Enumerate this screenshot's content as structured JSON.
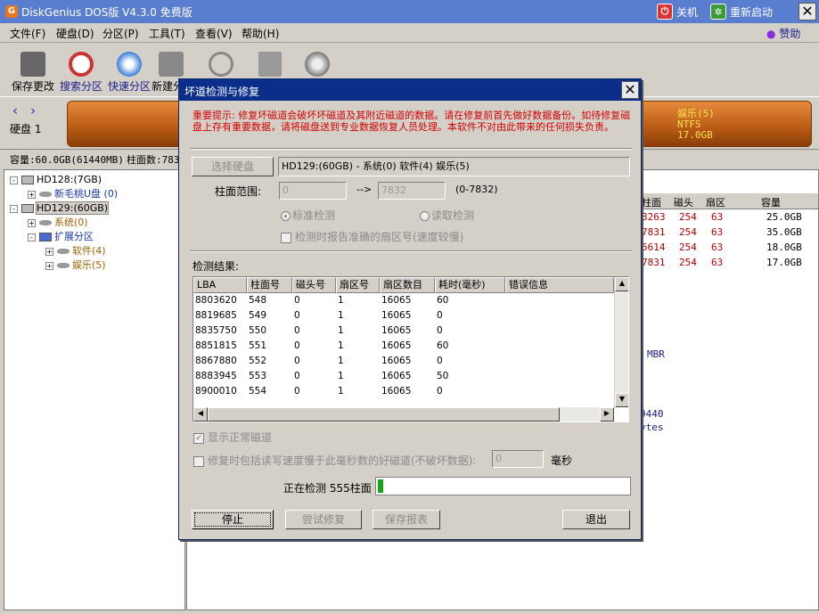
{
  "app": {
    "title": "DiskGenius DOS版 V4.3.0 免费版",
    "logo": "G",
    "shutdown": "关机",
    "restart": "重新启动"
  },
  "menu": [
    "文件(F)",
    "硬盘(D)",
    "分区(P)",
    "工具(T)",
    "查看(V)",
    "帮助(H)"
  ],
  "sponsor": "赞助",
  "toolbar": [
    "保存更改",
    "搜索分区",
    "快速分区",
    "新建分"
  ],
  "diskbar": {
    "disk_label": "硬盘 1",
    "partition_name": "娱乐(5)",
    "partition_fs": "NTFS",
    "partition_size": "17.0GB"
  },
  "infoline": {
    "capacity": "容量:60.0GB(61440MB)",
    "cylinders": "柱面数:783"
  },
  "tree": [
    {
      "label": "HD128:(7GB)",
      "level": 0,
      "exp": "-",
      "icon": "hd"
    },
    {
      "label": "新毛桃U盘 (0)",
      "level": 1,
      "exp": "+",
      "icon": "pt",
      "color": "#1a3aa8"
    },
    {
      "label": "HD129:(60GB)",
      "level": 0,
      "exp": "-",
      "icon": "hd",
      "selected": true
    },
    {
      "label": "系统(0)",
      "level": 1,
      "exp": "+",
      "icon": "pt",
      "color": "#a06000"
    },
    {
      "label": "扩展分区",
      "level": 1,
      "exp": "-",
      "icon": "ext",
      "color": "#1a3aa8"
    },
    {
      "label": "软件(4)",
      "level": 2,
      "exp": "+",
      "icon": "pt",
      "color": "#a06000"
    },
    {
      "label": "娱乐(5)",
      "level": 2,
      "exp": "+",
      "icon": "pt",
      "color": "#a06000"
    }
  ],
  "right_table": {
    "headers": [
      "柱面",
      "磁头",
      "扇区",
      "容量"
    ],
    "rows": [
      [
        "3263",
        "254",
        "63",
        "25.0GB"
      ],
      [
        "7831",
        "254",
        "63",
        "35.0GB"
      ],
      [
        "5614",
        "254",
        "63",
        "18.0GB"
      ],
      [
        "7831",
        "254",
        "63",
        "17.0GB"
      ]
    ],
    "mbr": "MBR",
    "num": "9440",
    "bytes": "ytes"
  },
  "dialog": {
    "title": "坏道检测与修复",
    "warning": "重要提示: 修复坏磁道会破坏坏磁道及其附近磁道的数据。请在修复前首先做好数据备份。如待修复磁盘上存有重要数据，请将磁盘送到专业数据恢复人员处理。本软件不对由此带来的任何损失负责。",
    "select_disk": "选择硬盘",
    "disk_info": "HD129:(60GB) - 系统(0) 软件(4) 娱乐(5)",
    "cyl_range_label": "柱面范围:",
    "cyl_from": "0",
    "arrow": "-->",
    "cyl_to": "7832",
    "cyl_hint": "(0-7832)",
    "mode_standard": "标准检测",
    "mode_read": "读取检测",
    "report_sector": "检测时报告准确的扇区号(速度较慢)",
    "results_label": "检测结果:",
    "columns": [
      "LBA",
      "柱面号",
      "磁头号",
      "扇区号",
      "扇区数目",
      "耗时(毫秒)",
      "错误信息"
    ],
    "rows": [
      [
        "8803620",
        "548",
        "0",
        "1",
        "16065",
        "60",
        ""
      ],
      [
        "8819685",
        "549",
        "0",
        "1",
        "16065",
        "0",
        ""
      ],
      [
        "8835750",
        "550",
        "0",
        "1",
        "16065",
        "0",
        ""
      ],
      [
        "8851815",
        "551",
        "0",
        "1",
        "16065",
        "60",
        ""
      ],
      [
        "8867880",
        "552",
        "0",
        "1",
        "16065",
        "0",
        ""
      ],
      [
        "8883945",
        "553",
        "0",
        "1",
        "16065",
        "50",
        ""
      ],
      [
        "8900010",
        "554",
        "0",
        "1",
        "16065",
        "0",
        ""
      ]
    ],
    "show_normal": "显示正常磁道",
    "repair_slow": "修复时包括读写速度慢于此毫秒数的好磁道(不破坏数据):",
    "slow_ms": "0",
    "ms_unit": "毫秒",
    "status": "正在检测 555柱面",
    "progress": 0.03,
    "buttons": {
      "stop": "停止",
      "repair": "尝试修复",
      "save": "保存报表",
      "exit": "退出"
    }
  }
}
